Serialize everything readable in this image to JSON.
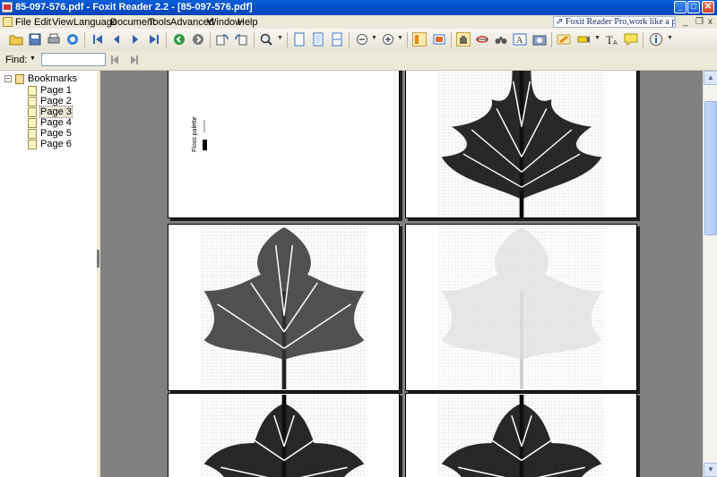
{
  "window": {
    "title": "85-097-576.pdf - Foxit Reader 2.2 - [85-097-576.pdf]",
    "minimize": "_",
    "maximize": "□",
    "close": "✕"
  },
  "menu": {
    "items": [
      "File",
      "Edit",
      "View",
      "Language",
      "Document",
      "Tools",
      "Advanced",
      "Window",
      "Help"
    ],
    "promo": "Foxit Reader Pro,work like a pro!",
    "mdi_minimize": "_",
    "mdi_restore": "❐",
    "mdi_close": "x"
  },
  "findbar": {
    "label": "Find:",
    "value": ""
  },
  "bookmarks": {
    "root": "Bookmarks",
    "items": [
      "Page 1",
      "Page 2",
      "Page 3",
      "Page 4",
      "Page 5",
      "Page 6"
    ],
    "selected": "Page 3"
  },
  "document": {
    "legend_title": "Floss palette"
  },
  "colors": {
    "titlebar": "#0450CC",
    "background": "#808080",
    "chrome": "#ECE9D8"
  }
}
